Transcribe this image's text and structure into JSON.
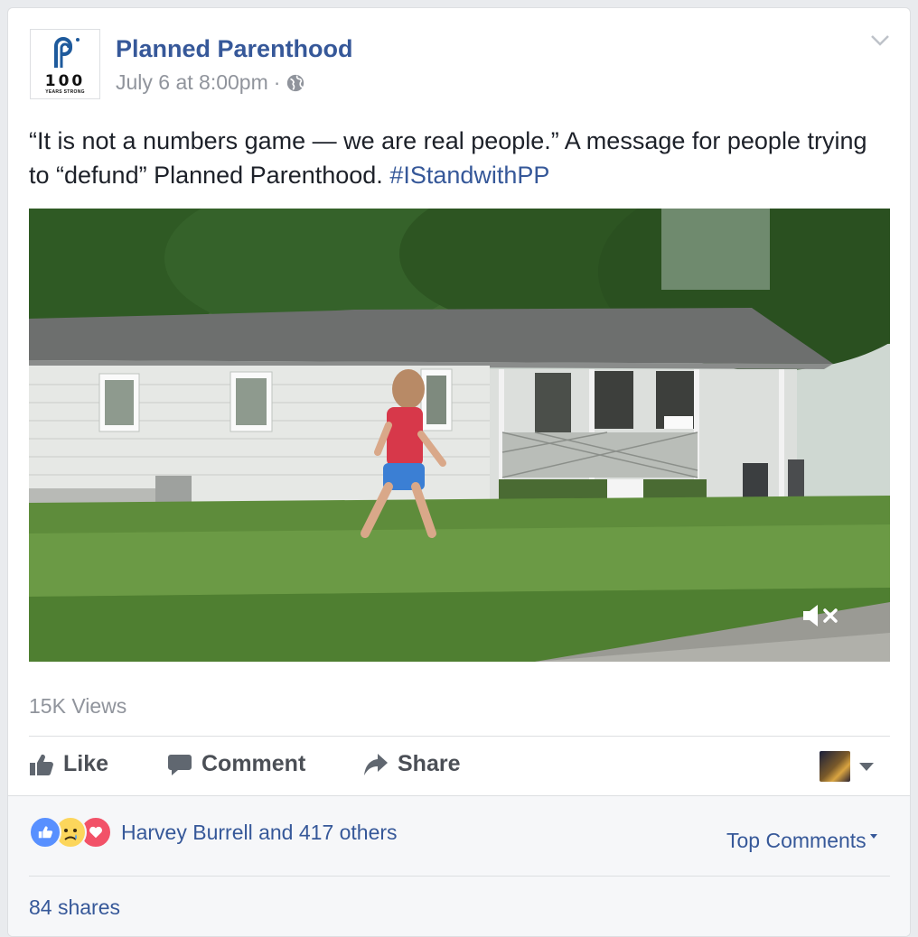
{
  "post": {
    "page_name": "Planned Parenthood",
    "timestamp": "July 6 at 8:00pm",
    "separator": "·",
    "privacy_icon": "globe-icon",
    "text_main": "“It is not a numbers game — we are real people.” A message for people trying to “defund” Planned Parenthood.",
    "hashtag": "#IStandwithPP",
    "logo": {
      "number": "100",
      "tagline": "YEARS STRONG",
      "brand_color": "#1e5a9c"
    }
  },
  "video": {
    "views": "15K Views",
    "mute_icon": "muted-speaker-icon"
  },
  "actions": {
    "like": "Like",
    "comment": "Comment",
    "share": "Share"
  },
  "footer": {
    "reactions": [
      "like",
      "sad",
      "love"
    ],
    "reaction_text": "Harvey Burrell and 417 others",
    "top_comments": "Top Comments",
    "shares": "84 shares"
  },
  "colors": {
    "link": "#365899",
    "text": "#1d2129",
    "muted": "#90949c",
    "like": "#5890ff",
    "love": "#f25268",
    "sad": "#fcd65c"
  }
}
